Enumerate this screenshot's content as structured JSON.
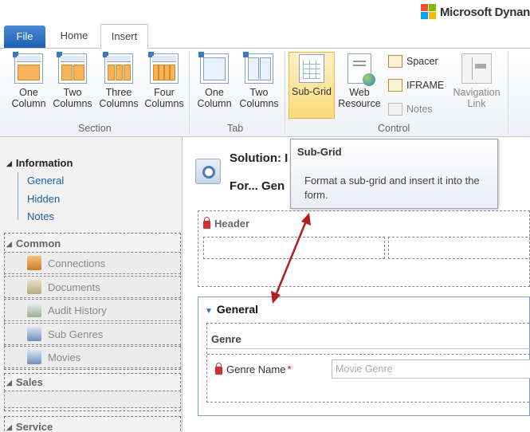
{
  "app": {
    "logo_text": "Microsoft Dynan"
  },
  "tabs": {
    "file": "File",
    "home": "Home",
    "insert": "Insert"
  },
  "ribbon": {
    "section": {
      "label": "Section",
      "buttons": [
        {
          "line1": "One",
          "line2": "Column"
        },
        {
          "line1": "Two",
          "line2": "Columns"
        },
        {
          "line1": "Three",
          "line2": "Columns"
        },
        {
          "line1": "Four",
          "line2": "Columns"
        }
      ]
    },
    "tab": {
      "label": "Tab",
      "buttons": [
        {
          "line1": "One",
          "line2": "Column"
        },
        {
          "line1": "Two",
          "line2": "Columns"
        }
      ]
    },
    "control": {
      "label": "Control",
      "subgrid": "Sub-Grid",
      "web_resource": {
        "line1": "Web",
        "line2": "Resource"
      },
      "spacer": "Spacer",
      "iframe": "IFRAME",
      "notes": "Notes",
      "navigation_link": {
        "line1": "Navigation",
        "line2": "Link"
      }
    }
  },
  "nav": {
    "information": "Information",
    "info_links": [
      "General",
      "Hidden",
      "Notes"
    ],
    "common": "Common",
    "common_items": [
      "Connections",
      "Documents",
      "Audit History",
      "Sub Genres",
      "Movies"
    ],
    "sales": "Sales",
    "service": "Service"
  },
  "main": {
    "solution_label": "Solution: I",
    "form_label": "For... Gen",
    "header_title": "Header",
    "general_title": "General",
    "genre_section": "Genre",
    "genre_field_label": "Genre Name",
    "required_mark": "*",
    "genre_placeholder": "Movie Genre"
  },
  "tooltip": {
    "title": "Sub-Grid",
    "description": "Format a sub-grid and insert it into the form."
  },
  "colors": {
    "accent": "#1c5fb4",
    "highlight": "#fbdb7a",
    "arrow": "#b01e1e",
    "lock": "#d03030"
  }
}
